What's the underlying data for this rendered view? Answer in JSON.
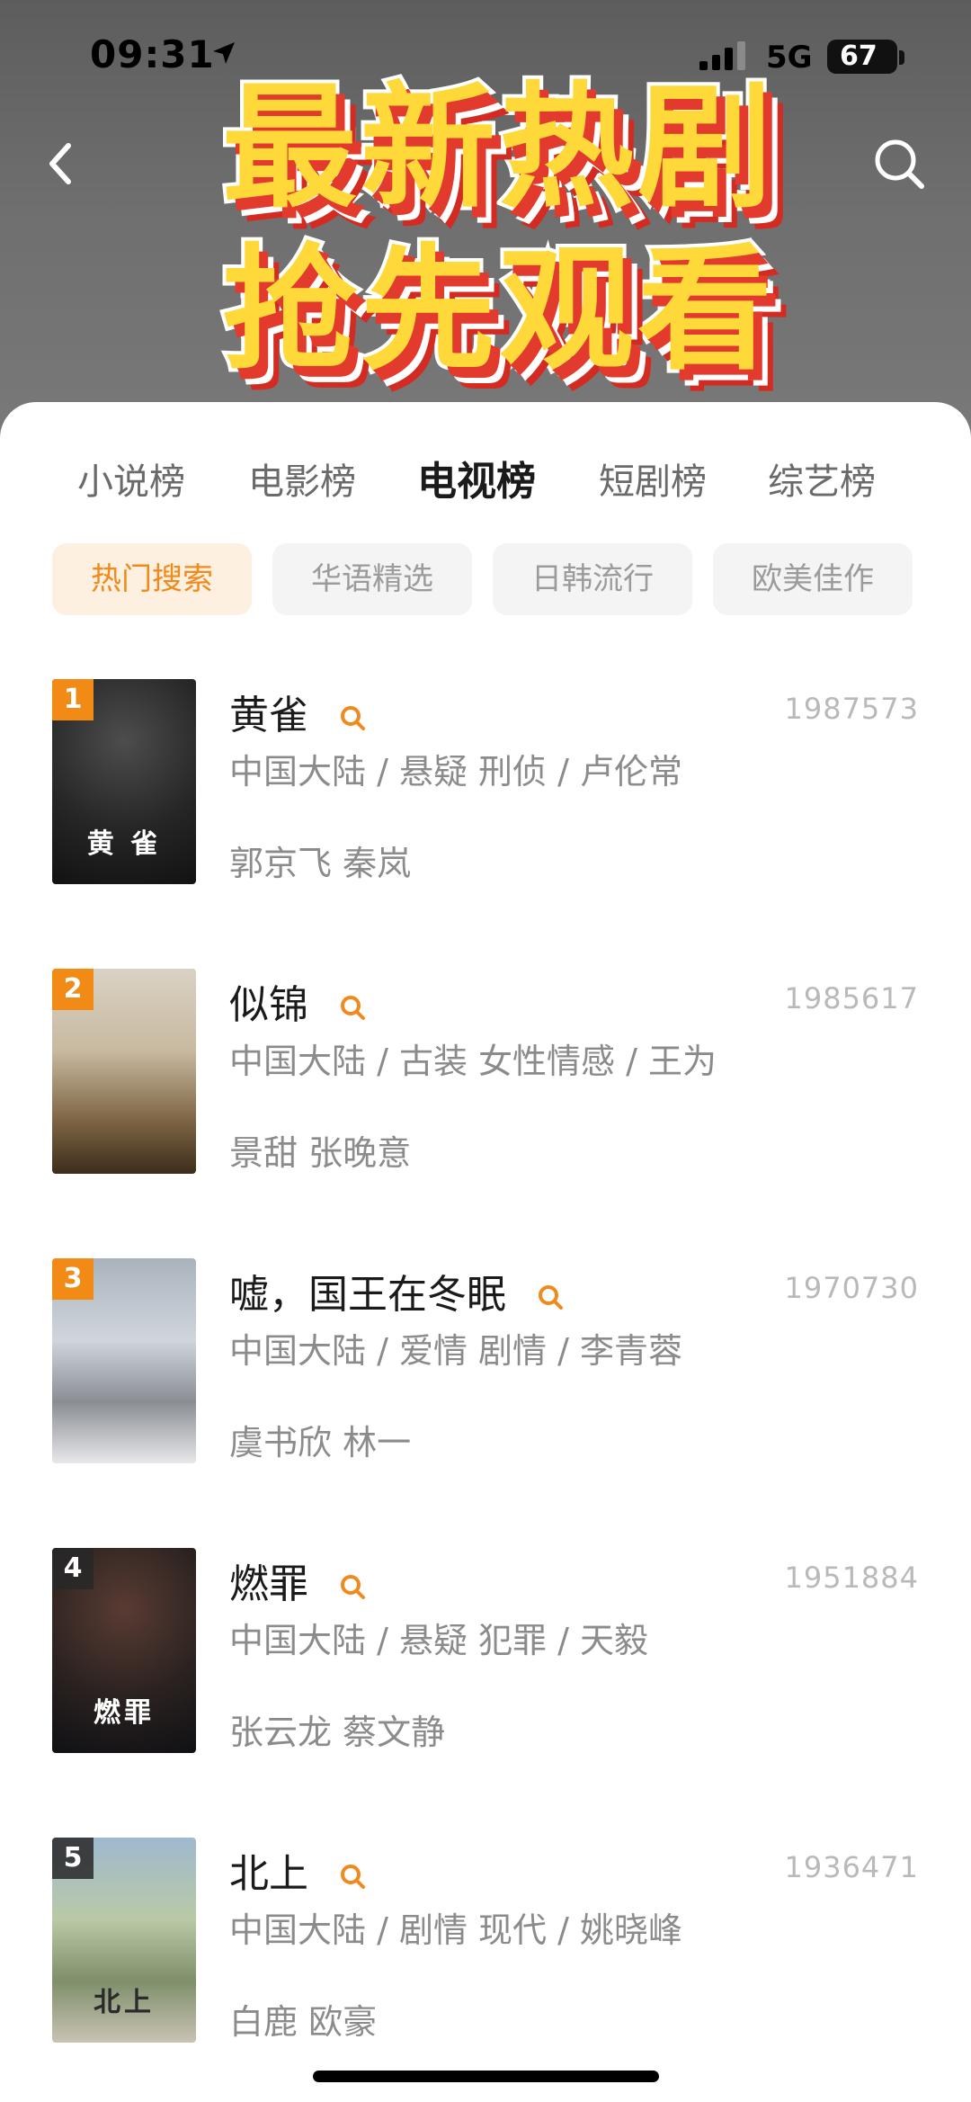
{
  "status_bar": {
    "time": "09:31",
    "network": "5G",
    "battery": "67"
  },
  "banner": {
    "line1": "最新热剧",
    "line2": "抢先观看"
  },
  "tabs": [
    {
      "label": "小说榜"
    },
    {
      "label": "电影榜"
    },
    {
      "label": "电视榜",
      "active": true
    },
    {
      "label": "短剧榜"
    },
    {
      "label": "综艺榜"
    }
  ],
  "filters": [
    {
      "label": "热门搜索",
      "active": true
    },
    {
      "label": "华语精选"
    },
    {
      "label": "日韩流行"
    },
    {
      "label": "欧美佳作"
    }
  ],
  "items": [
    {
      "rank": "1",
      "title": "黄雀",
      "heat": "1987573",
      "meta": "中国大陆 / 悬疑 刑侦 / 卢伦常",
      "cast": "郭京飞 秦岚",
      "poster_text": "黄 雀"
    },
    {
      "rank": "2",
      "title": "似锦",
      "heat": "1985617",
      "meta": "中国大陆 / 古装 女性情感 / 王为",
      "cast": "景甜 张晚意",
      "poster_text": ""
    },
    {
      "rank": "3",
      "title": "嘘，国王在冬眠",
      "heat": "1970730",
      "meta": "中国大陆 / 爱情 剧情 / 李青蓉",
      "cast": "虞书欣 林一",
      "poster_text": ""
    },
    {
      "rank": "4",
      "title": "燃罪",
      "heat": "1951884",
      "meta": "中国大陆 / 悬疑 犯罪 / 天毅",
      "cast": "张云龙 蔡文静",
      "poster_text": "燃罪"
    },
    {
      "rank": "5",
      "title": "北上",
      "heat": "1936471",
      "meta": "中国大陆 / 剧情 现代 / 姚晓峰",
      "cast": "白鹿 欧豪",
      "poster_text": "北上"
    }
  ],
  "colors": {
    "accent": "#f08a1c",
    "banner_yellow": "#ffd83a",
    "banner_red": "#e23a2d"
  }
}
